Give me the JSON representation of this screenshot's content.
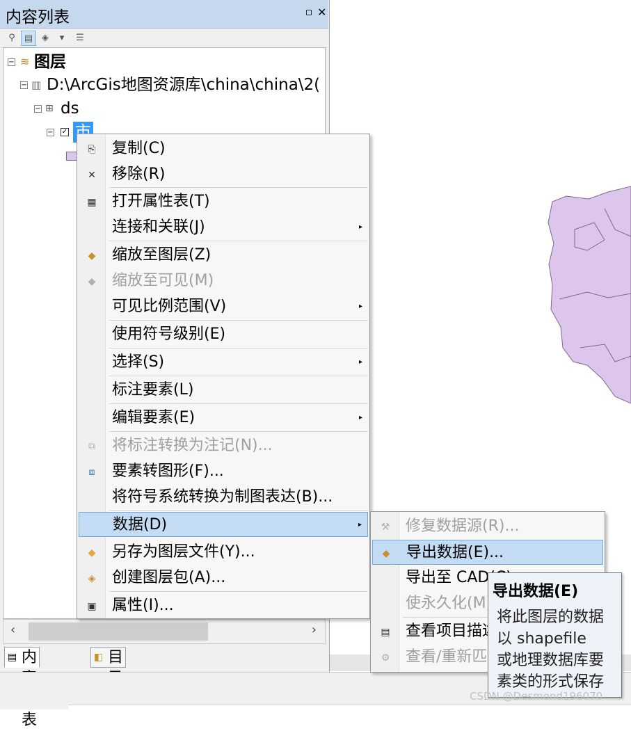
{
  "toc": {
    "title": "内容列表",
    "tree": {
      "root_label": "图层",
      "source_path": "D:\\ArcGis地图资源库\\china\\china\\2(",
      "group_label": "ds",
      "layer_label": "市"
    },
    "tabs": [
      {
        "label": "内容列表"
      },
      {
        "label": "目录"
      }
    ]
  },
  "context_menu": {
    "items": [
      {
        "label": "复制(C)",
        "icon": "copy-icon"
      },
      {
        "label": "移除(R)",
        "icon": "remove-icon"
      },
      {
        "label": "打开属性表(T)",
        "icon": "table-icon"
      },
      {
        "label": "连接和关联(J)"
      },
      {
        "label": "缩放至图层(Z)",
        "icon": "zoom-layer-icon"
      },
      {
        "label": "缩放至可见(M)",
        "icon": "zoom-visible-icon",
        "disabled": true
      },
      {
        "label": "可见比例范围(V)"
      },
      {
        "label": "使用符号级别(E)"
      },
      {
        "label": "选择(S)"
      },
      {
        "label": "标注要素(L)"
      },
      {
        "label": "编辑要素(E)"
      },
      {
        "label": "将标注转换为注记(N)...",
        "icon": "convert-label-icon",
        "disabled": true
      },
      {
        "label": "要素转图形(F)...",
        "icon": "feature-graphic-icon"
      },
      {
        "label": "将符号系统转换为制图表达(B)..."
      },
      {
        "label": "数据(D)",
        "highlighted": true
      },
      {
        "label": "另存为图层文件(Y)...",
        "icon": "layer-file-icon"
      },
      {
        "label": "创建图层包(A)...",
        "icon": "layer-package-icon"
      },
      {
        "label": "属性(I)...",
        "icon": "properties-icon"
      }
    ]
  },
  "submenu": {
    "items": [
      {
        "label": "修复数据源(R)...",
        "icon": "repair-source-icon",
        "disabled": true
      },
      {
        "label": "导出数据(E)...",
        "icon": "export-data-icon",
        "highlighted": true
      },
      {
        "label": "导出至 CAD(C)..."
      },
      {
        "label": "使永久化(M)",
        "disabled": true
      },
      {
        "label": "查看项目描述",
        "icon": "item-description-icon"
      },
      {
        "label": "查看/重新匹配",
        "icon": "rematch-icon",
        "disabled": true
      }
    ]
  },
  "tooltip": {
    "title": "导出数据(E)",
    "lines": [
      "将此图层的数据",
      "以 shapefile",
      "或地理数据库要",
      "素类的形式保存"
    ]
  },
  "watermark": "CSDN @Desmond196070",
  "colors": {
    "map_fill": "#dcc6ec",
    "selection": "#3399ff",
    "menu_highlight": "#c3dcf4",
    "title_bar": "#c5d8ee"
  }
}
